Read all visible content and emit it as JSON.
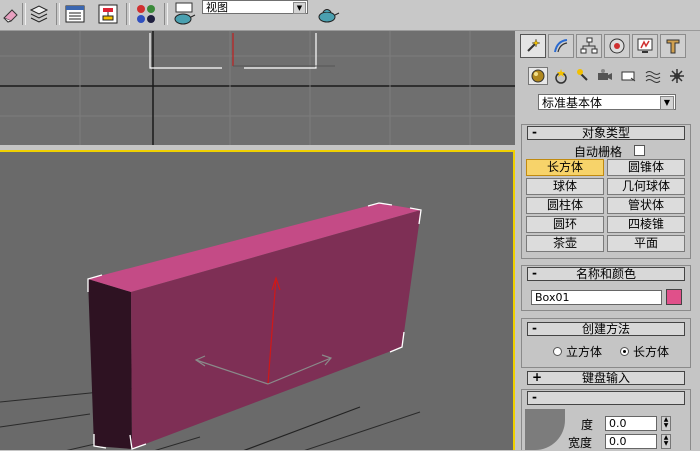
{
  "toolbar": {
    "view_dropdown": "视图",
    "icons": [
      "eraser-icon",
      "layer-manager-icon",
      "track-view-icon",
      "schematic-icon",
      "material-editor-icon",
      "render-scene-icon",
      "quick-render-icon"
    ]
  },
  "command_panel": {
    "tabs": [
      "create",
      "modify",
      "hierarchy",
      "motion",
      "display",
      "utilities"
    ],
    "subcategories": [
      "geometry",
      "shapes",
      "lights",
      "cameras",
      "helpers",
      "space-warps",
      "systems"
    ],
    "category_dropdown": "标准基本体",
    "object_type": {
      "title": "对象类型",
      "autogrid_label": "自动栅格",
      "buttons": [
        "长方体",
        "圆锥体",
        "球体",
        "几何球体",
        "圆柱体",
        "管状体",
        "圆环",
        "四棱锥",
        "茶壶",
        "平面"
      ],
      "active": "长方体"
    },
    "name_color": {
      "title": "名称和颜色",
      "name_value": "Box01",
      "color": "#e0508a"
    },
    "creation_method": {
      "title": "创建方法",
      "option_cube": "立方体",
      "option_box": "长方体",
      "selected": "长方体"
    },
    "keyboard_entry": {
      "title": "键盘输入"
    },
    "parameters": {
      "partial_label": "度",
      "length_value": "0.0",
      "width_label": "宽度",
      "width_value": "0.0"
    }
  },
  "colors": {
    "box_front": "#7e2f55",
    "box_top": "#c44b86",
    "box_side": "#2e1222",
    "viewport_bg": "#6a6a6a",
    "active_border": "#f0d000"
  }
}
